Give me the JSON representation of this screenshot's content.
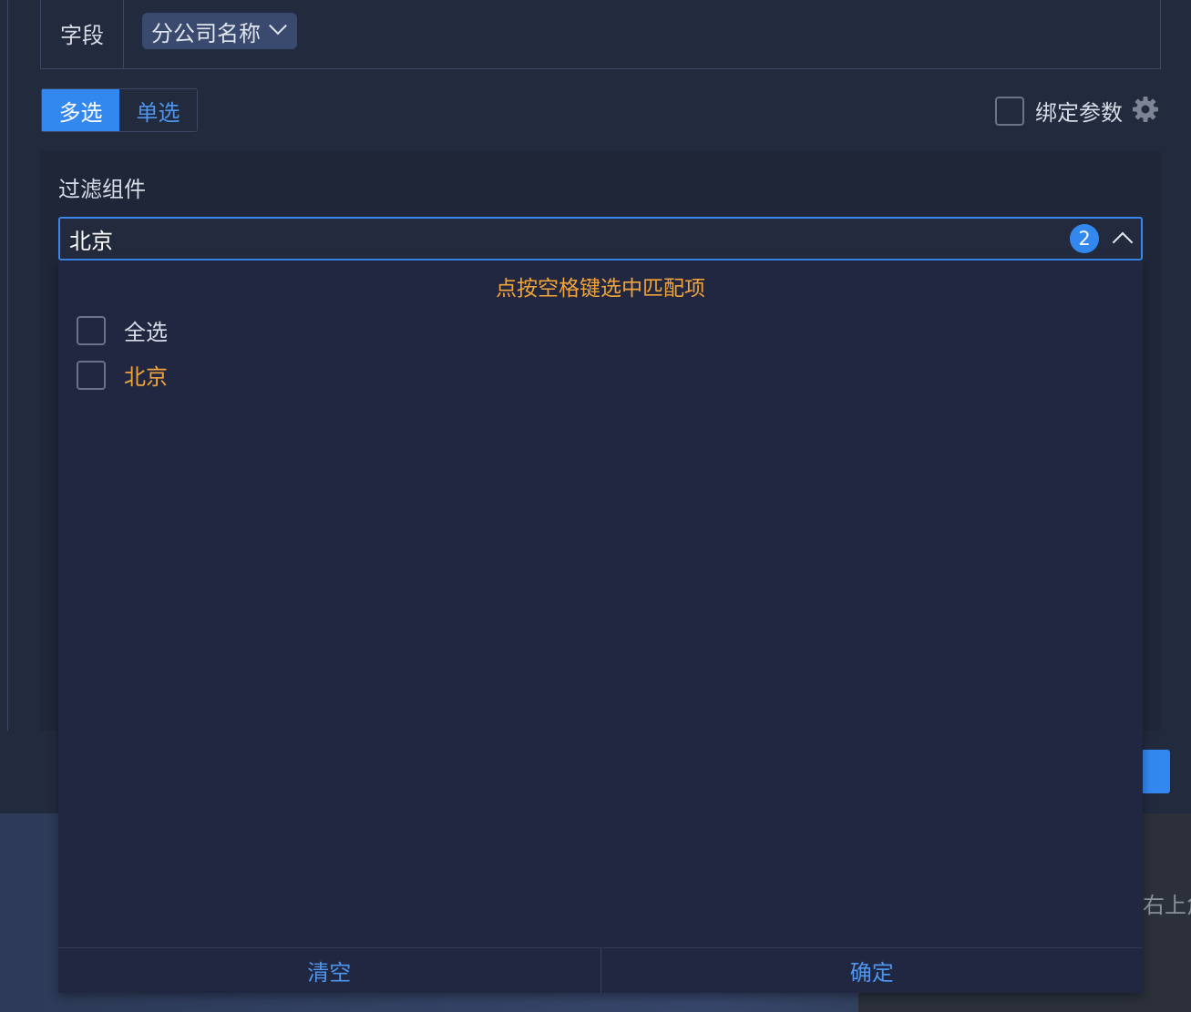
{
  "field_row": {
    "label": "字段",
    "selected_field": "分公司名称"
  },
  "mode_toggle": {
    "multi_label": "多选",
    "single_label": "单选",
    "active": "多选"
  },
  "bind_params": {
    "label": "绑定参数",
    "checked": false
  },
  "filter_panel": {
    "title": "过滤组件",
    "search_value": "北京",
    "match_count": "2",
    "hint": "点按空格键选中匹配项",
    "options": [
      {
        "label": "全选",
        "checked": false
      },
      {
        "label": "北京",
        "checked": false
      }
    ],
    "clear_label": "清空",
    "confirm_label": "确定"
  },
  "background": {
    "corner_text": "右上角"
  },
  "colors": {
    "accent": "#3388f0",
    "highlight": "#f2a43a",
    "panel_bg": "#1f2638"
  }
}
